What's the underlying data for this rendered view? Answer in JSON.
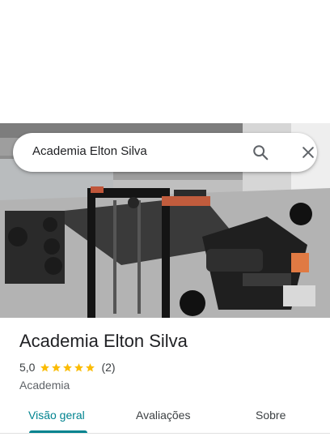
{
  "search": {
    "query": "Academia Elton Silva",
    "search_icon": "search-icon",
    "close_icon": "close-icon"
  },
  "place": {
    "name": "Academia Elton Silva",
    "rating": "5,0",
    "stars": 5,
    "reviews": "(2)",
    "category": "Academia"
  },
  "tabs": [
    {
      "label": "Visão geral",
      "active": true
    },
    {
      "label": "Avaliações",
      "active": false
    },
    {
      "label": "Sobre",
      "active": false
    }
  ],
  "colors": {
    "accent": "#00838f",
    "star": "#fbbc04",
    "text": "#202124",
    "secondary_text": "#5f6368"
  }
}
